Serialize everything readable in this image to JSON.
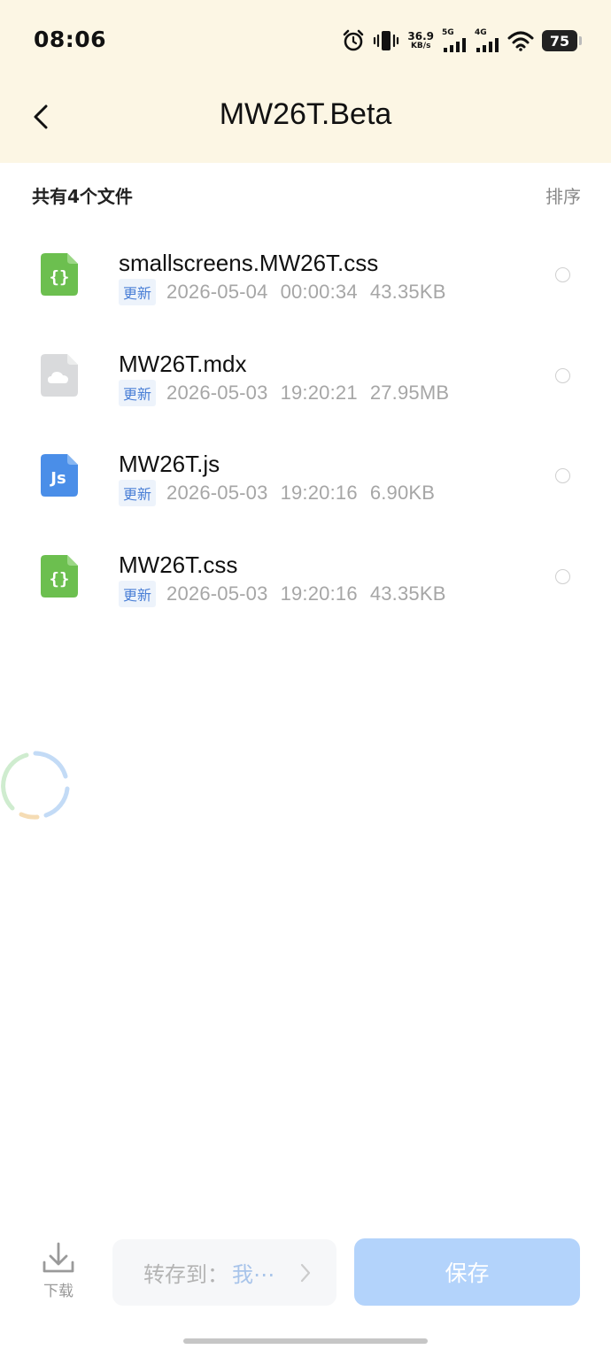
{
  "status_bar": {
    "time": "08:06",
    "net_speed_value": "36.9",
    "net_speed_unit": "KB/s",
    "signal_1_label": "5G",
    "signal_2_label": "4G",
    "battery_level": "75",
    "icons": [
      "alarm-icon",
      "vibrate-icon",
      "signal-icon",
      "wifi-icon",
      "battery-icon"
    ]
  },
  "header": {
    "title": "MW26T.Beta",
    "back_icon": "chevron-left-icon"
  },
  "list_header": {
    "count_label": "共有4个文件",
    "sort_label": "排序"
  },
  "files": [
    {
      "name": "smallscreens.MW26T.css",
      "tag": "更新",
      "date": "2026-05-04",
      "time": "00:00:34",
      "size": "43.35KB",
      "icon": "code-file-icon",
      "icon_color": "#6cbf4f"
    },
    {
      "name": "MW26T.mdx",
      "tag": "更新",
      "date": "2026-05-03",
      "time": "19:20:21",
      "size": "27.95MB",
      "icon": "cloud-file-icon",
      "icon_color": "#d9dadc"
    },
    {
      "name": "MW26T.js",
      "tag": "更新",
      "date": "2026-05-03",
      "time": "19:20:16",
      "size": "6.90KB",
      "icon": "js-file-icon",
      "icon_color": "#4a8ee8"
    },
    {
      "name": "MW26T.css",
      "tag": "更新",
      "date": "2026-05-03",
      "time": "19:20:16",
      "size": "43.35KB",
      "icon": "code-file-icon",
      "icon_color": "#6cbf4f"
    }
  ],
  "bottom_bar": {
    "download_label": "下载",
    "save_to_label": "转存到：",
    "save_to_value": "我⋯",
    "save_label": "保存"
  },
  "colors": {
    "header_bg": "#fcf6e4",
    "tag_text": "#4a7fd6",
    "save_button_bg": "#b3d3fb"
  }
}
